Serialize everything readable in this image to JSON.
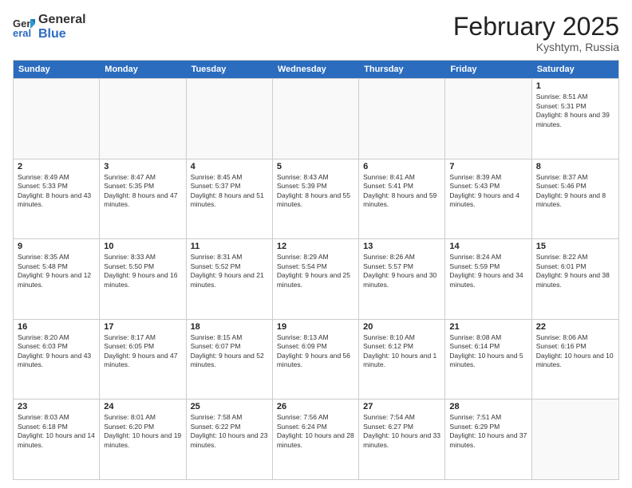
{
  "logo": {
    "general": "General",
    "blue": "Blue"
  },
  "title": {
    "month": "February 2025",
    "location": "Kyshtym, Russia"
  },
  "days_of_week": [
    "Sunday",
    "Monday",
    "Tuesday",
    "Wednesday",
    "Thursday",
    "Friday",
    "Saturday"
  ],
  "weeks": [
    [
      {
        "day": "",
        "info": ""
      },
      {
        "day": "",
        "info": ""
      },
      {
        "day": "",
        "info": ""
      },
      {
        "day": "",
        "info": ""
      },
      {
        "day": "",
        "info": ""
      },
      {
        "day": "",
        "info": ""
      },
      {
        "day": "1",
        "info": "Sunrise: 8:51 AM\nSunset: 5:31 PM\nDaylight: 8 hours and 39 minutes."
      }
    ],
    [
      {
        "day": "2",
        "info": "Sunrise: 8:49 AM\nSunset: 5:33 PM\nDaylight: 8 hours and 43 minutes."
      },
      {
        "day": "3",
        "info": "Sunrise: 8:47 AM\nSunset: 5:35 PM\nDaylight: 8 hours and 47 minutes."
      },
      {
        "day": "4",
        "info": "Sunrise: 8:45 AM\nSunset: 5:37 PM\nDaylight: 8 hours and 51 minutes."
      },
      {
        "day": "5",
        "info": "Sunrise: 8:43 AM\nSunset: 5:39 PM\nDaylight: 8 hours and 55 minutes."
      },
      {
        "day": "6",
        "info": "Sunrise: 8:41 AM\nSunset: 5:41 PM\nDaylight: 8 hours and 59 minutes."
      },
      {
        "day": "7",
        "info": "Sunrise: 8:39 AM\nSunset: 5:43 PM\nDaylight: 9 hours and 4 minutes."
      },
      {
        "day": "8",
        "info": "Sunrise: 8:37 AM\nSunset: 5:46 PM\nDaylight: 9 hours and 8 minutes."
      }
    ],
    [
      {
        "day": "9",
        "info": "Sunrise: 8:35 AM\nSunset: 5:48 PM\nDaylight: 9 hours and 12 minutes."
      },
      {
        "day": "10",
        "info": "Sunrise: 8:33 AM\nSunset: 5:50 PM\nDaylight: 9 hours and 16 minutes."
      },
      {
        "day": "11",
        "info": "Sunrise: 8:31 AM\nSunset: 5:52 PM\nDaylight: 9 hours and 21 minutes."
      },
      {
        "day": "12",
        "info": "Sunrise: 8:29 AM\nSunset: 5:54 PM\nDaylight: 9 hours and 25 minutes."
      },
      {
        "day": "13",
        "info": "Sunrise: 8:26 AM\nSunset: 5:57 PM\nDaylight: 9 hours and 30 minutes."
      },
      {
        "day": "14",
        "info": "Sunrise: 8:24 AM\nSunset: 5:59 PM\nDaylight: 9 hours and 34 minutes."
      },
      {
        "day": "15",
        "info": "Sunrise: 8:22 AM\nSunset: 6:01 PM\nDaylight: 9 hours and 38 minutes."
      }
    ],
    [
      {
        "day": "16",
        "info": "Sunrise: 8:20 AM\nSunset: 6:03 PM\nDaylight: 9 hours and 43 minutes."
      },
      {
        "day": "17",
        "info": "Sunrise: 8:17 AM\nSunset: 6:05 PM\nDaylight: 9 hours and 47 minutes."
      },
      {
        "day": "18",
        "info": "Sunrise: 8:15 AM\nSunset: 6:07 PM\nDaylight: 9 hours and 52 minutes."
      },
      {
        "day": "19",
        "info": "Sunrise: 8:13 AM\nSunset: 6:09 PM\nDaylight: 9 hours and 56 minutes."
      },
      {
        "day": "20",
        "info": "Sunrise: 8:10 AM\nSunset: 6:12 PM\nDaylight: 10 hours and 1 minute."
      },
      {
        "day": "21",
        "info": "Sunrise: 8:08 AM\nSunset: 6:14 PM\nDaylight: 10 hours and 5 minutes."
      },
      {
        "day": "22",
        "info": "Sunrise: 8:06 AM\nSunset: 6:16 PM\nDaylight: 10 hours and 10 minutes."
      }
    ],
    [
      {
        "day": "23",
        "info": "Sunrise: 8:03 AM\nSunset: 6:18 PM\nDaylight: 10 hours and 14 minutes."
      },
      {
        "day": "24",
        "info": "Sunrise: 8:01 AM\nSunset: 6:20 PM\nDaylight: 10 hours and 19 minutes."
      },
      {
        "day": "25",
        "info": "Sunrise: 7:58 AM\nSunset: 6:22 PM\nDaylight: 10 hours and 23 minutes."
      },
      {
        "day": "26",
        "info": "Sunrise: 7:56 AM\nSunset: 6:24 PM\nDaylight: 10 hours and 28 minutes."
      },
      {
        "day": "27",
        "info": "Sunrise: 7:54 AM\nSunset: 6:27 PM\nDaylight: 10 hours and 33 minutes."
      },
      {
        "day": "28",
        "info": "Sunrise: 7:51 AM\nSunset: 6:29 PM\nDaylight: 10 hours and 37 minutes."
      },
      {
        "day": "",
        "info": ""
      }
    ]
  ]
}
